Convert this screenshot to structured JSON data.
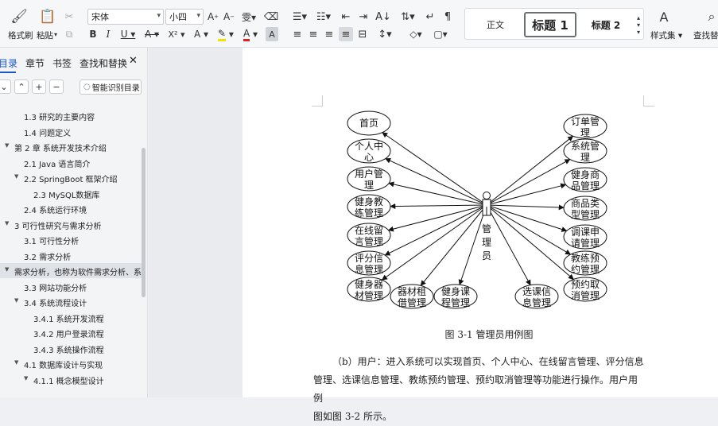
{
  "ribbon": {
    "clipboard": {
      "format_painter": "格式刷",
      "paste": "粘贴"
    },
    "font": {
      "name": "宋体",
      "size": "小四"
    },
    "styles": {
      "normal": "正文",
      "heading1": "标题 1",
      "heading2": "标题 2",
      "style_set": "样式集"
    },
    "find_replace": "查找替换"
  },
  "sidebar": {
    "tabs": [
      "目录",
      "章节",
      "书签",
      "查找和替换"
    ],
    "smart_toc_label": "智能识别目录",
    "toc": [
      {
        "level": 2,
        "text": "1.3  研究的主要内容",
        "arrow": false
      },
      {
        "level": 2,
        "text": "1.4  问题定义",
        "arrow": false
      },
      {
        "level": 1,
        "text": "第 2 章   系统开发技术介绍",
        "arrow": true
      },
      {
        "level": 2,
        "text": "2.1 Java 语言简介",
        "arrow": false
      },
      {
        "level": 2,
        "text": "2.2 SpringBoot 框架介绍",
        "arrow": true
      },
      {
        "level": 3,
        "text": "2.3     MySQL数据库",
        "arrow": false
      },
      {
        "level": 2,
        "text": "2.4     系统运行环境",
        "arrow": false
      },
      {
        "level": 1,
        "text": "3  可行性研究与需求分析",
        "arrow": true
      },
      {
        "level": 2,
        "text": "3.1 可行性分析",
        "arrow": false
      },
      {
        "level": 2,
        "text": "3.2  需求分析",
        "arrow": false
      },
      {
        "level": 0,
        "text": "需求分析，也称为软件需求分析、系…",
        "arrow": true,
        "selected": true
      },
      {
        "level": 2,
        "text": "3.3 网站功能分析",
        "arrow": false
      },
      {
        "level": 2,
        "text": "3.4 系统流程设计",
        "arrow": true
      },
      {
        "level": 3,
        "text": "3.4.1  系统开发流程",
        "arrow": false
      },
      {
        "level": 3,
        "text": "3.4.2  用户登录流程",
        "arrow": false
      },
      {
        "level": 3,
        "text": "3.4.3  系统操作流程",
        "arrow": false
      },
      {
        "level": 2,
        "text": "4.1  数据库设计与实现",
        "arrow": true
      },
      {
        "level": 3,
        "text": "4.1.1  概念模型设计",
        "arrow": true
      }
    ]
  },
  "document": {
    "diagram": {
      "actor_label": [
        "管",
        "理",
        "员"
      ],
      "left_use_cases": [
        [
          "首页"
        ],
        [
          "个人中",
          "心"
        ],
        [
          "用户管",
          "理"
        ],
        [
          "健身教",
          "练管理"
        ],
        [
          "在线留",
          "言管理"
        ],
        [
          "评分信",
          "息管理"
        ],
        [
          "健身器",
          "材管理"
        ]
      ],
      "bottom_use_cases": [
        [
          "器材租",
          "借管理"
        ],
        [
          "健身课",
          "程管理"
        ],
        [
          "选课信",
          "息管理"
        ]
      ],
      "right_use_cases": [
        [
          "订单管",
          "理"
        ],
        [
          "系统管",
          "理"
        ],
        [
          "健身商",
          "品管理"
        ],
        [
          "商品类",
          "型管理"
        ],
        [
          "调课申",
          "请管理"
        ],
        [
          "教练预",
          "约管理"
        ],
        [
          "预约取",
          "消管理"
        ]
      ]
    },
    "caption": "图 3-1    管理员用例图",
    "paragraph_lines": [
      "（b）用户：进入系统可以实现首页、个人中心、在线留言管理、评分信息",
      "管理、选课信息管理、教练预约管理、预约取消管理等功能进行操作。用户用例",
      "图如图 3-2 所示。"
    ]
  }
}
